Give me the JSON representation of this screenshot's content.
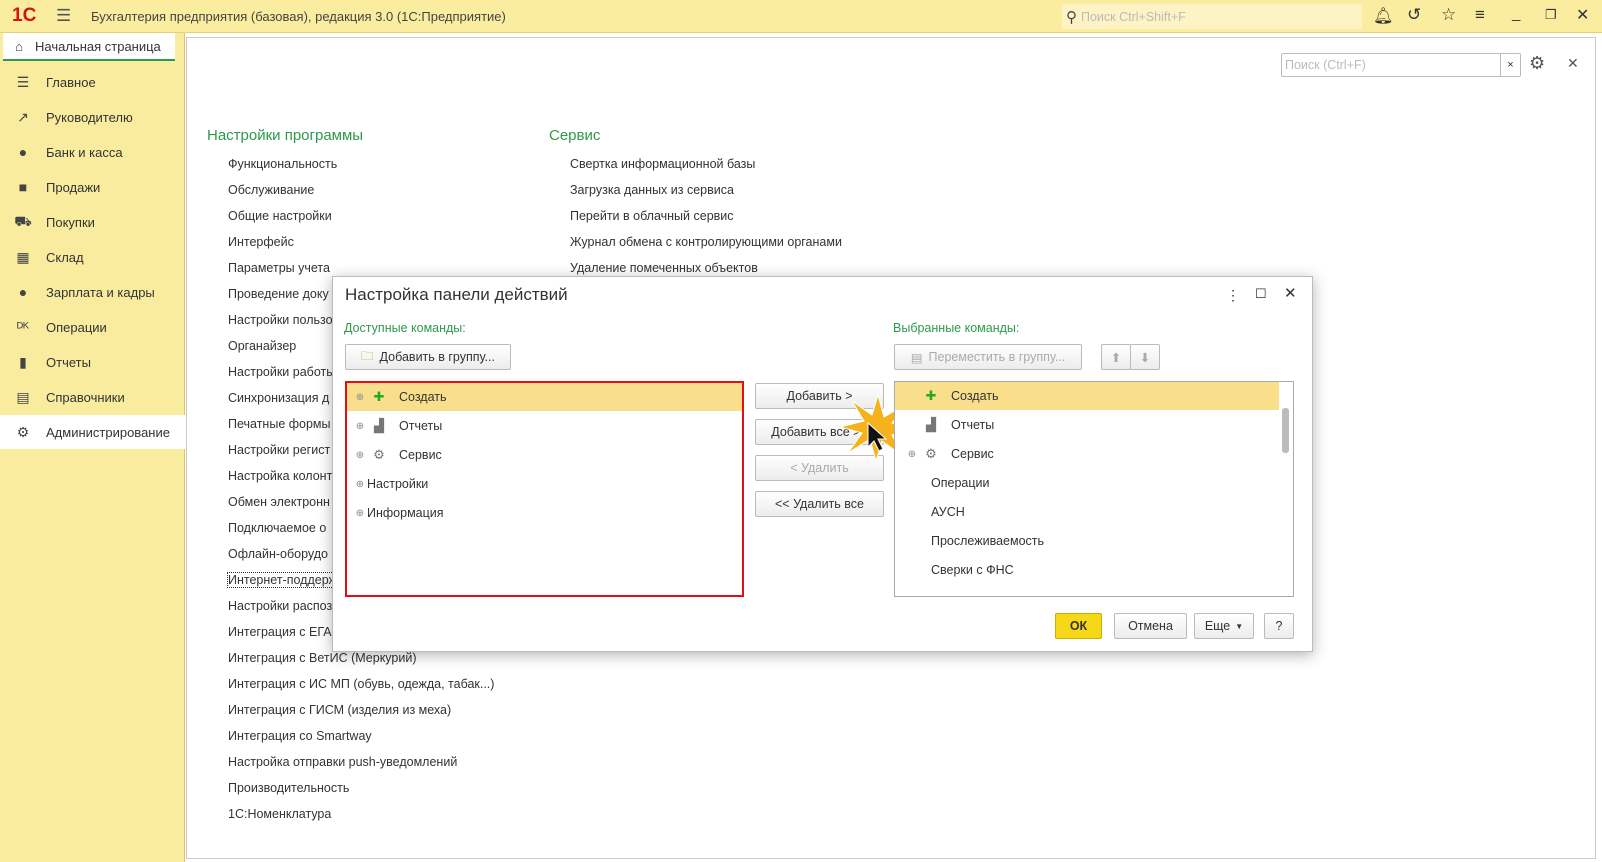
{
  "titlebar": {
    "logo": "1С",
    "title": "Бухгалтерия предприятия (базовая), редакция 3.0  (1С:Предприятие)",
    "search_placeholder": "Поиск Ctrl+Shift+F"
  },
  "home_tab": "Начальная страница",
  "sidebar": {
    "items": [
      {
        "label": "Главное",
        "icon": "menu-icon"
      },
      {
        "label": "Руководителю",
        "icon": "trend-icon"
      },
      {
        "label": "Банк и касса",
        "icon": "coin-icon"
      },
      {
        "label": "Продажи",
        "icon": "bag-icon"
      },
      {
        "label": "Покупки",
        "icon": "cart-icon"
      },
      {
        "label": "Склад",
        "icon": "grid-icon"
      },
      {
        "label": "Зарплата и кадры",
        "icon": "person-icon"
      },
      {
        "label": "Операции",
        "icon": "dt-kt-icon"
      },
      {
        "label": "Отчеты",
        "icon": "bar-chart-icon"
      },
      {
        "label": "Справочники",
        "icon": "book-icon"
      },
      {
        "label": "Администрирование",
        "icon": "gear-icon",
        "active": true
      }
    ]
  },
  "page": {
    "search_placeholder": "Поиск (Ctrl+F)",
    "settings": {
      "title": "Настройки программы",
      "links": [
        "Функциональность",
        "Обслуживание",
        "Общие настройки",
        "Интерфейс",
        "Параметры учета",
        "Проведение доку",
        "Настройки пользо",
        "Органайзер",
        "Настройки работы",
        "Синхронизация д",
        "Печатные формы",
        "Настройки регист",
        "Настройка колонт",
        "Обмен электронн",
        "Подключаемое о",
        "Офлайн-оборудо",
        "Интернет-поддерж",
        "Настройки распоз",
        "Интеграция с ЕГА",
        "Интеграция с ВетИС (Меркурий)",
        "Интеграция с ИС МП (обувь, одежда, табак...)",
        "Интеграция с ГИСМ (изделия из меха)",
        "Интеграция со Smartway",
        "Настройка отправки push-уведомлений",
        "Производительность",
        "1С:Номенклатура"
      ]
    },
    "service": {
      "title": "Сервис",
      "links": [
        "Свертка информационной базы",
        "Загрузка данных из сервиса",
        "Перейти в облачный сервис",
        "Журнал обмена с контролирующими органами",
        "Удаление помеченных объектов"
      ]
    }
  },
  "dialog": {
    "title": "Настройка панели действий",
    "available_label": "Доступные команды:",
    "add_to_group": "Добавить в группу...",
    "available": [
      {
        "label": "Создать",
        "icon": "create-icon",
        "sel": true
      },
      {
        "label": "Отчеты",
        "icon": "report-icon"
      },
      {
        "label": "Сервис",
        "icon": "gear-icon"
      },
      {
        "label": "Настройки"
      },
      {
        "label": "Информация"
      }
    ],
    "add": "Добавить >",
    "add_all": "Добавить все >>",
    "remove": "< Удалить",
    "remove_all": "<< Удалить все",
    "selected_label": "Выбранные команды:",
    "move_to_group": "Переместить в группу...",
    "selected": [
      {
        "label": "Создать",
        "icon": "create-icon",
        "sel": true
      },
      {
        "label": "Отчеты",
        "icon": "report-icon"
      },
      {
        "label": "Сервис",
        "icon": "gear-icon",
        "expand": true
      },
      {
        "label": "Операции"
      },
      {
        "label": "АУСН"
      },
      {
        "label": "Прослеживаемость"
      },
      {
        "label": "Сверки с ФНС"
      }
    ],
    "ok": "ОК",
    "cancel": "Отмена",
    "more": "Еще",
    "help": "?"
  },
  "colors": {
    "accent": "#2e9a4b",
    "titlebar": "#fbeda0",
    "highlight": "#e0101a",
    "ok": "#f7d818"
  }
}
